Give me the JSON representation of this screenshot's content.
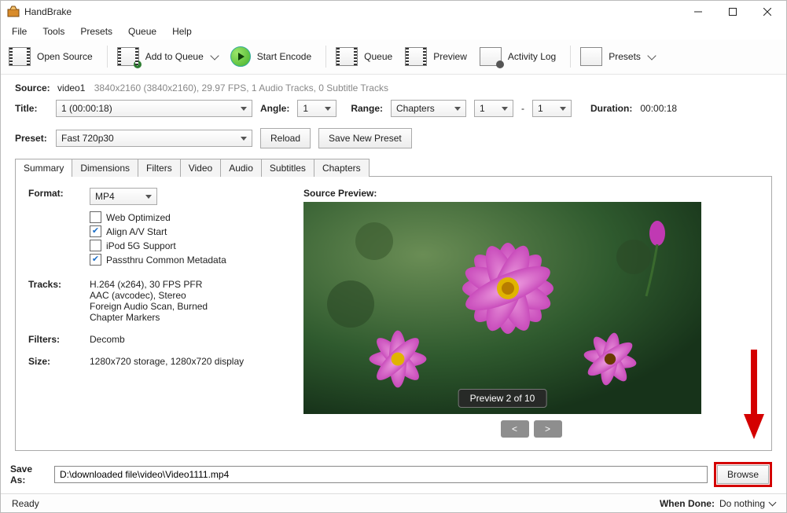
{
  "app": {
    "title": "HandBrake"
  },
  "menu": {
    "file": "File",
    "tools": "Tools",
    "presets": "Presets",
    "queue": "Queue",
    "help": "Help"
  },
  "toolbar": {
    "open_source": "Open Source",
    "add_to_queue": "Add to Queue",
    "start_encode": "Start Encode",
    "queue": "Queue",
    "preview": "Preview",
    "activity_log": "Activity Log",
    "presets": "Presets"
  },
  "source": {
    "label": "Source:",
    "name": "video1",
    "info": "3840x2160 (3840x2160), 29.97 FPS, 1 Audio Tracks, 0 Subtitle Tracks"
  },
  "title_row": {
    "title_label": "Title:",
    "title_value": "1  (00:00:18)",
    "angle_label": "Angle:",
    "angle_value": "1",
    "range_label": "Range:",
    "range_type": "Chapters",
    "chap_from": "1",
    "dash": "-",
    "chap_to": "1",
    "duration_label": "Duration:",
    "duration_value": "00:00:18"
  },
  "preset": {
    "label": "Preset:",
    "value": "Fast 720p30",
    "reload": "Reload",
    "save_new": "Save New Preset"
  },
  "tabs": {
    "summary": "Summary",
    "dimensions": "Dimensions",
    "filters": "Filters",
    "video": "Video",
    "audio": "Audio",
    "subtitles": "Subtitles",
    "chapters": "Chapters"
  },
  "summary": {
    "format_label": "Format:",
    "format_value": "MP4",
    "web_optimized": "Web Optimized",
    "align_av": "Align A/V Start",
    "ipod": "iPod 5G Support",
    "passthru": "Passthru Common Metadata",
    "tracks_label": "Tracks:",
    "track1": "H.264 (x264), 30 FPS PFR",
    "track2": "AAC (avcodec), Stereo",
    "track3": "Foreign Audio Scan, Burned",
    "track4": "Chapter Markers",
    "filters_label": "Filters:",
    "filters_value": "Decomb",
    "size_label": "Size:",
    "size_value": "1280x720 storage, 1280x720 display",
    "preview_label": "Source Preview:",
    "preview_badge": "Preview 2 of 10",
    "prev": "<",
    "next": ">"
  },
  "save": {
    "label": "Save As:",
    "path": "D:\\downloaded file\\video\\Video1111.mp4",
    "browse": "Browse"
  },
  "status": {
    "ready": "Ready",
    "when_done_label": "When Done:",
    "when_done_value": "Do nothing"
  }
}
